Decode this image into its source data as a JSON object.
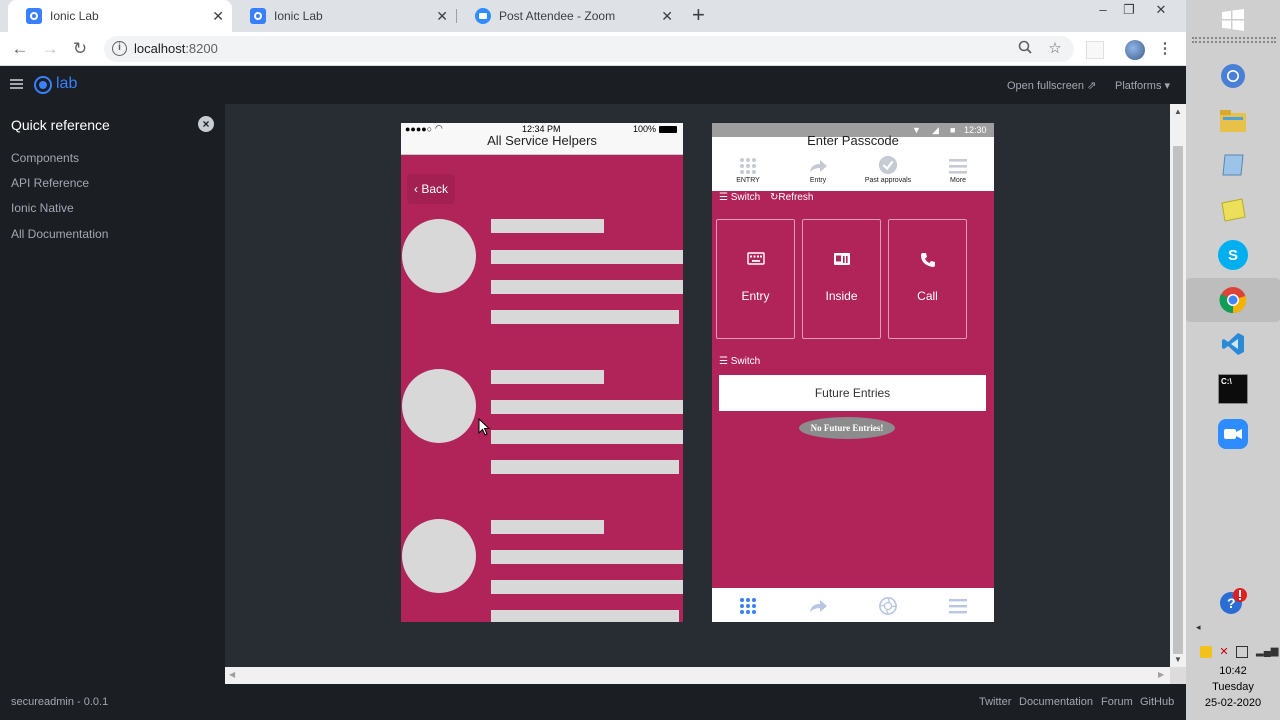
{
  "browser": {
    "tabs": [
      {
        "title": "Ionic Lab",
        "active": true
      },
      {
        "title": "Ionic Lab",
        "active": false
      },
      {
        "title": "Post Attendee - Zoom",
        "active": false
      }
    ],
    "new_tab_label": "+",
    "url_host": "localhost",
    "url_port": ":8200",
    "window_controls": {
      "minimize": "–",
      "restore": "❐",
      "close": "✕"
    }
  },
  "lab": {
    "logo_text": "lab",
    "open_fullscreen": "Open fullscreen",
    "platforms": "Platforms"
  },
  "sidebar": {
    "title": "Quick reference",
    "items": [
      {
        "label": "Components"
      },
      {
        "label": "API Reference"
      },
      {
        "label": "Ionic Native"
      },
      {
        "label": "All Documentation"
      }
    ],
    "version": "secureadmin - 0.0.1"
  },
  "footer_links": [
    "Twitter",
    "Documentation",
    "Forum",
    "GitHub"
  ],
  "ios_phone": {
    "status_time": "12:34 PM",
    "status_battery": "100%",
    "title": "All Service Helpers",
    "back_label": "Back"
  },
  "md_phone": {
    "status_time": "12:30",
    "title": "Enter Passcode",
    "tabs": [
      {
        "label": "ENTRY",
        "icon": "grid-icon"
      },
      {
        "label": "Entry",
        "icon": "share-arrow-icon"
      },
      {
        "label": "Past approvals",
        "icon": "check-circle-icon"
      },
      {
        "label": "More",
        "icon": "menu-icon"
      }
    ],
    "switch_label": "Switch",
    "refresh_label": "Refresh",
    "tiles": [
      {
        "label": "Entry",
        "icon": "keyboard-icon"
      },
      {
        "label": "Inside",
        "icon": "id-card-icon"
      },
      {
        "label": "Call",
        "icon": "phone-icon"
      }
    ],
    "switch_label_2": "Switch",
    "future_entries_button": "Future Entries",
    "no_future_entries": "No Future Entries!"
  },
  "taskbar": {
    "time": "10:42",
    "day": "Tuesday",
    "date": "25-02-2020"
  },
  "colors": {
    "app_accent": "#b0245a",
    "ionic_blue": "#3880ff",
    "lab_bg": "#1b1e23",
    "stage_bg": "#282c33"
  }
}
